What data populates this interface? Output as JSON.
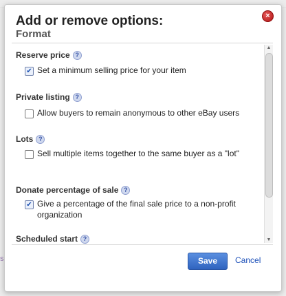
{
  "background": {
    "snippet": "s"
  },
  "dialog": {
    "title": "Add or remove options:",
    "subtitle": "Format",
    "close_icon": "close-icon",
    "options": [
      {
        "label": "Reserve price",
        "checked": true,
        "description": "Set a minimum selling price for your item"
      },
      {
        "label": "Private listing",
        "checked": false,
        "description": "Allow buyers to remain anonymous to other eBay users"
      },
      {
        "label": "Lots",
        "checked": false,
        "description": "Sell multiple items together to the same buyer as a \"lot\""
      },
      {
        "label": "Donate percentage of sale",
        "checked": true,
        "description": "Give a percentage of the final sale price to a non-profit organization"
      },
      {
        "label": "Scheduled start",
        "checked": true,
        "description": ""
      }
    ],
    "help_glyph": "?",
    "save_label": "Save",
    "cancel_label": "Cancel"
  },
  "colors": {
    "accent": "#2f63bf",
    "close": "#b31212",
    "link": "#1b4fb8"
  }
}
